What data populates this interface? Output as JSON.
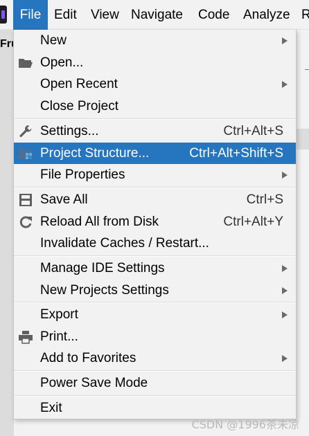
{
  "menubar": {
    "items": [
      "File",
      "Edit",
      "View",
      "Navigate",
      "Code",
      "Analyze",
      "R"
    ]
  },
  "background": {
    "project_label": "Fru"
  },
  "menu": {
    "new": "New",
    "open": "Open...",
    "open_recent": "Open Recent",
    "close_project": "Close Project",
    "settings": "Settings...",
    "settings_shortcut": "Ctrl+Alt+S",
    "project_structure": "Project Structure...",
    "project_structure_shortcut": "Ctrl+Alt+Shift+S",
    "file_properties": "File Properties",
    "save_all": "Save All",
    "save_all_shortcut": "Ctrl+S",
    "reload_all": "Reload All from Disk",
    "reload_all_shortcut": "Ctrl+Alt+Y",
    "invalidate_caches": "Invalidate Caches / Restart...",
    "manage_ide_settings": "Manage IDE Settings",
    "new_projects_settings": "New Projects Settings",
    "export": "Export",
    "print": "Print...",
    "add_to_favorites": "Add to Favorites",
    "power_save_mode": "Power Save Mode",
    "exit": "Exit"
  },
  "watermark": "CSDN @1996茶未凉",
  "colors": {
    "selection": "#2675bf",
    "menu_background": "#f2f2f2"
  },
  "icons": {
    "open": "folder-open-icon",
    "settings": "wrench-icon",
    "project_structure": "project-structure-icon",
    "save_all": "save-icon",
    "reload_all": "reload-icon",
    "print": "printer-icon"
  }
}
